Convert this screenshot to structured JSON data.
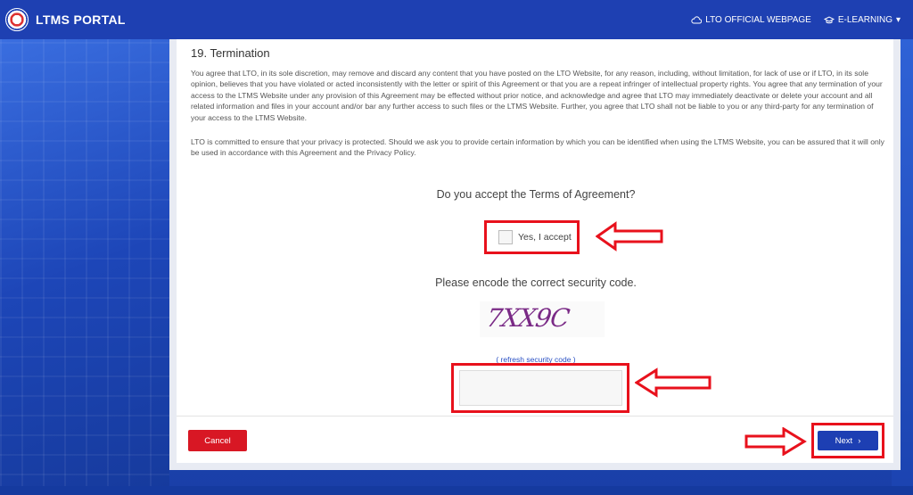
{
  "header": {
    "brand": "LTMS PORTAL",
    "links": [
      {
        "label": "LTO OFFICIAL WEBPAGE",
        "icon": "cloud-icon"
      },
      {
        "label": "E-LEARNING",
        "icon": "graduation-cap-icon"
      }
    ],
    "dropdown_caret": "▾"
  },
  "terms": {
    "heading": "19. Termination",
    "paragraph_1": "You agree that LTO, in its sole discretion, may remove and discard any content that you have posted on the LTO Website, for any reason, including, without limitation, for lack of use or if LTO, in its sole opinion, believes that you have violated or acted inconsistently with the letter or spirit of this Agreement or that you are a repeat infringer of intellectual property rights. You agree that any termination of your access to the LTMS Website under any provision of this Agreement may be effected without prior notice, and acknowledge and agree that LTO may immediately deactivate or delete your account and all related information and files in your account and/or bar any further access to such files or the LTMS Website. Further, you agree that LTO shall not be liable to you or any third-party for any termination of your access to the LTMS Website.",
    "paragraph_2": "LTO is committed to ensure that your privacy is protected. Should we ask you to provide certain information by which you can be identified when using the LTMS Website, you can be assured that it will only be used in accordance with this Agreement and the Privacy Policy."
  },
  "agreement": {
    "question": "Do you accept the Terms of Agreement?",
    "checkbox_label": "Yes, I accept",
    "checked": false
  },
  "security": {
    "prompt": "Please encode the correct security code.",
    "captcha_text": "7XX9C",
    "refresh_label": "( refresh security code )",
    "input_value": ""
  },
  "actions": {
    "cancel_label": "Cancel",
    "next_label": "Next",
    "next_icon": "›"
  },
  "colors": {
    "brand_blue": "#1e40b2",
    "cancel_red": "#d81724",
    "annotation_red": "#e8111c",
    "link_blue": "#2b51c4"
  }
}
